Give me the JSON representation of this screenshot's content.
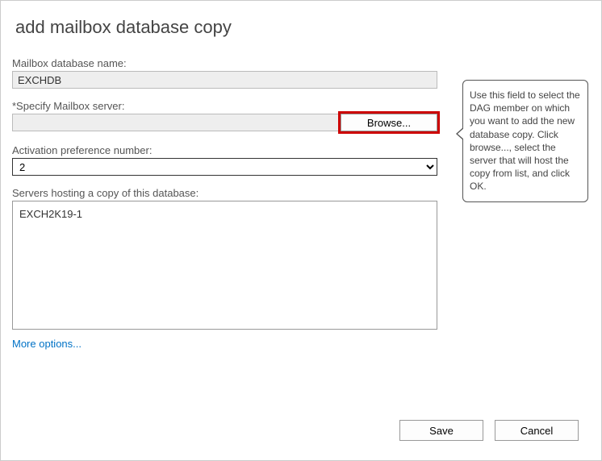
{
  "header": {
    "title": "add mailbox database copy"
  },
  "fields": {
    "db_name_label": "Mailbox database name:",
    "db_name_value": "EXCHDB",
    "server_label": "*Specify Mailbox server:",
    "server_value": "",
    "browse_label": "Browse...",
    "activation_label": "Activation preference number:",
    "activation_value": "2",
    "hosting_label": "Servers hosting a copy of this database:",
    "hosting_servers": [
      "EXCH2K19-1"
    ],
    "more_options": "More options..."
  },
  "callout": {
    "text": "Use this field to select the DAG member on which you want to add the new database copy. Click browse..., select the server that will host the copy from list, and click OK."
  },
  "footer": {
    "save": "Save",
    "cancel": "Cancel"
  }
}
